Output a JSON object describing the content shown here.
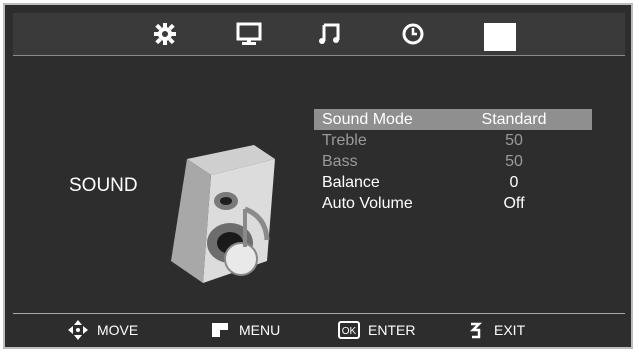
{
  "top_tabs": [
    {
      "icon": "gear-icon"
    },
    {
      "icon": "monitor-icon"
    },
    {
      "icon": "music-note-icon"
    },
    {
      "icon": "clock-icon"
    },
    {
      "icon": "blank-active-tab"
    }
  ],
  "section": {
    "label": "SOUND"
  },
  "menu": {
    "items": [
      {
        "label": "Sound Mode",
        "value": "Standard",
        "state": "selected"
      },
      {
        "label": "Treble",
        "value": "50",
        "state": "disabled"
      },
      {
        "label": "Bass",
        "value": "50",
        "state": "disabled"
      },
      {
        "label": "Balance",
        "value": "0",
        "state": "normal"
      },
      {
        "label": "Auto Volume",
        "value": "Off",
        "state": "normal"
      }
    ]
  },
  "footer": {
    "move": "MOVE",
    "menu": "MENU",
    "enter": "ENTER",
    "exit": "EXIT",
    "ok_icon_text": "OK"
  },
  "colors": {
    "background": "#2d2d2d",
    "selection": "#8f8f8f",
    "text": "#ffffff",
    "disabled_text": "#9a9a9a"
  }
}
